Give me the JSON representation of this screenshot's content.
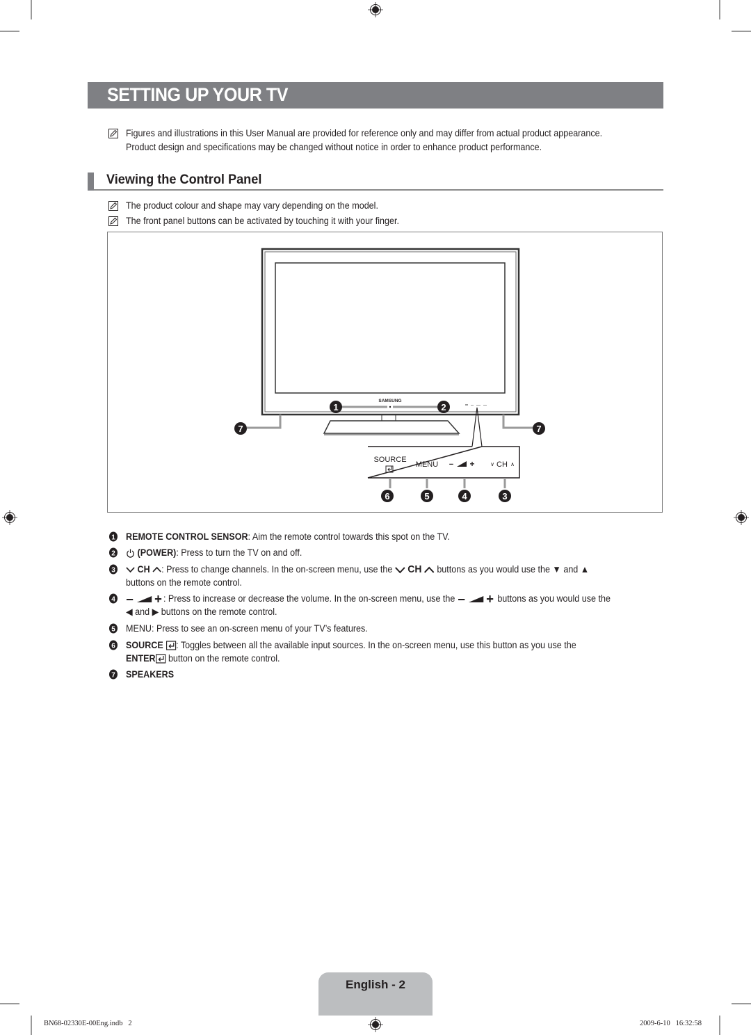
{
  "page": {
    "title": "SETTING UP YOUR TV",
    "intro_note": [
      "Figures and illustrations in this User Manual are provided for reference only and may differ from actual product appearance.",
      "Product design and specifications may be changed without notice in order to enhance product performance."
    ],
    "section": {
      "heading": "Viewing the Control Panel",
      "notes": [
        "The product colour and shape may vary depending on the model.",
        "The front panel buttons can be activated by touching it with your finger."
      ]
    }
  },
  "figure": {
    "brand": "SAMSUNG",
    "panel_labels": {
      "source": "SOURCE",
      "menu": "MENU",
      "volume_minus": "−",
      "volume_plus": "+",
      "ch_down": "∨",
      "ch": "CH",
      "ch_up": "∧"
    },
    "callouts": {
      "sensor": "1",
      "power": "2",
      "channel": "3",
      "volume": "4",
      "menu": "5",
      "source": "6",
      "speaker_left": "7",
      "speaker_right": "7"
    }
  },
  "descriptions": [
    {
      "num": "1",
      "label": "REMOTE CONTROL SENSOR",
      "text": ": Aim the remote control towards this spot on the TV."
    },
    {
      "num": "2",
      "label": "(POWER)",
      "text": ": Press to turn the TV on and off."
    },
    {
      "num": "3",
      "label": "CH",
      "text_a": ": Press to change channels. In the on-screen menu, use the",
      "label_b": "CH",
      "text_b": "buttons as you would use the ▼ and ▲",
      "text_c": "buttons on the remote control."
    },
    {
      "num": "4",
      "text_a": ": Press to increase or decrease the volume. In the on-screen menu, use the",
      "text_b": "buttons as you would use the",
      "text_c": "◀ and ▶ buttons on the remote control."
    },
    {
      "num": "5",
      "label": "MENU",
      "text": ": Press to see an on-screen menu of your TV’s features."
    },
    {
      "num": "6",
      "label": "SOURCE",
      "text_a": ": Toggles between all the available input sources. In the on-screen menu, use this button as you use the",
      "label_b": "ENTER",
      "text_b": "button on the remote control."
    },
    {
      "num": "7",
      "label": "SPEAKERS"
    }
  ],
  "footer": {
    "page_label": "English - 2",
    "slug_file": "BN68-02330E-00Eng.indb   2",
    "slug_date": "2009-6-10   16:32:58"
  }
}
